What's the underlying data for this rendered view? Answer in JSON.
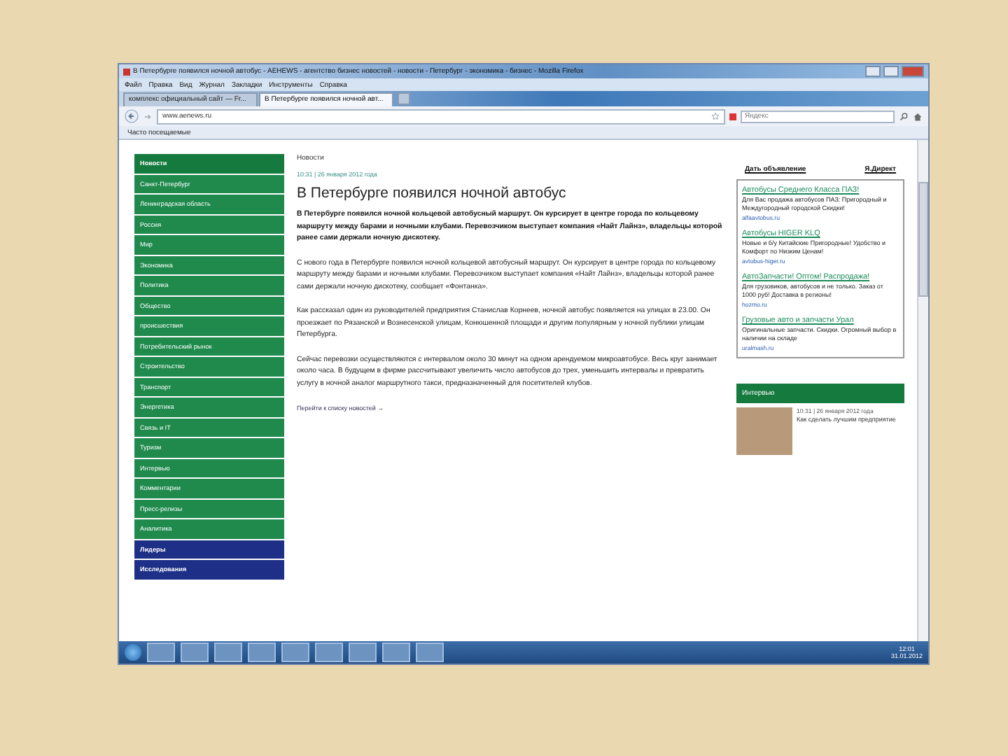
{
  "window": {
    "title": "В Петербурге появился ночной автобус - АЕНЕWS - агентство бизнес новостей - новости - Петербург - экономика - бизнес - Mozilla Firefox"
  },
  "menu": [
    "Файл",
    "Правка",
    "Вид",
    "Журнал",
    "Закладки",
    "Инструменты",
    "Справка"
  ],
  "tabs": [
    {
      "label": "комплекс официальный сайт — Fr...",
      "selected": false
    },
    {
      "label": "В Петербурге появился ночной авт...",
      "selected": true
    }
  ],
  "address": {
    "url": "www.aenews.ru"
  },
  "search": {
    "placeholder": "Яндекс"
  },
  "bookmarks": [
    "Часто посещаемые"
  ],
  "sidebar": {
    "items": [
      {
        "label": "Новости",
        "kind": "header"
      },
      {
        "label": "Санкт-Петербург",
        "kind": "link"
      },
      {
        "label": "Ленинградская область",
        "kind": "link"
      },
      {
        "label": "Россия",
        "kind": "link"
      },
      {
        "label": "Мир",
        "kind": "link"
      },
      {
        "label": "Экономика",
        "kind": "link"
      },
      {
        "label": "Политика",
        "kind": "link"
      },
      {
        "label": "Общество",
        "kind": "link"
      },
      {
        "label": "происшествия",
        "kind": "link"
      },
      {
        "label": "Потребительский рынок",
        "kind": "link"
      },
      {
        "label": "Строительство",
        "kind": "link"
      },
      {
        "label": "Транспорт",
        "kind": "link"
      },
      {
        "label": "Энергетика",
        "kind": "link"
      },
      {
        "label": "Связь и IT",
        "kind": "link"
      },
      {
        "label": "Туризм",
        "kind": "link"
      },
      {
        "label": "Интервью",
        "kind": "link"
      },
      {
        "label": "Комментарии",
        "kind": "link"
      },
      {
        "label": "Пресс-релизы",
        "kind": "link"
      },
      {
        "label": "Аналитика",
        "kind": "link"
      },
      {
        "label": "Лидеры",
        "kind": "special"
      },
      {
        "label": "Исследования",
        "kind": "special"
      }
    ]
  },
  "article": {
    "section": "Новости",
    "date": "10:31 | 26 января 2012 года",
    "headline": "В Петербурге появился ночной автобус",
    "lead": "В Петербурге появился ночной кольцевой автобусный маршрут. Он курсирует в центре города по кольцевому маршруту между барами и ночными клубами. Перевозчиком выступает компания «Найт Лайнз», владельцы которой ранее сами держали ночную дискотеку.",
    "paragraphs": [
      "С нового года в Петербурге появился ночной кольцевой автобусный маршрут. Он курсирует в центре города по кольцевому маршруту между барами и ночными клубами. Перевозчиком выступает компания «Найт Лайнз», владельцы которой ранее сами держали ночную дискотеку, сообщает «Фонтанка».",
      "Как рассказал один из руководителей предприятия Станислав Корнеев, ночной автобус появляется на улицах в 23.00. Он проезжает по Рязанской и Вознесенской улицам, Конюшенной площади и другим популярным у ночной публики улицам Петербурга.",
      "Сейчас перевозки осуществляются с интервалом около 30 минут на одном арендуемом микроавтобусе. Весь круг занимает около часа. В будущем в фирме рассчитывают увеличить число автобусов до трех, уменьшить интервалы и превратить услугу в ночной аналог маршрутного такси, предназначенный для посетителей клубов."
    ],
    "more_link": "Перейти к списку новостей →"
  },
  "right": {
    "links": [
      "Дать объявление",
      "Я.Директ"
    ],
    "ads": [
      {
        "title": "Автобусы Среднего Класса ПАЗ!",
        "text": "Для Вас продажа автобусов ПАЗ: Пригородный и Междугородный городской Скидки!",
        "url": "alfaavtobus.ru"
      },
      {
        "title": "Автобусы HIGER KLQ",
        "text": "Новые и б/у Китайские Пригородные! Удобство и Комфорт по Низким Ценам!",
        "url": "avtobus-higer.ru"
      },
      {
        "title": "АвтоЗапчасти! Оптом! Распродажа!",
        "text": "Для грузовиков, автобусов и не только. Заказ от 1000 руб! Доставка в регионы!",
        "url": "hozmo.ru"
      },
      {
        "title": "Грузовые авто и запчасти Урал",
        "text": "Оригинальные запчасти. Скидки. Огромный выбор в наличии на складе",
        "url": "uralmash.ru"
      }
    ],
    "interview": {
      "header": "Интервью",
      "date": "10:31 | 26 января 2012 года",
      "text": "Как сделать лучшим предприятие"
    }
  },
  "taskbar": {
    "time": "12:01",
    "date": "31.01.2012"
  }
}
